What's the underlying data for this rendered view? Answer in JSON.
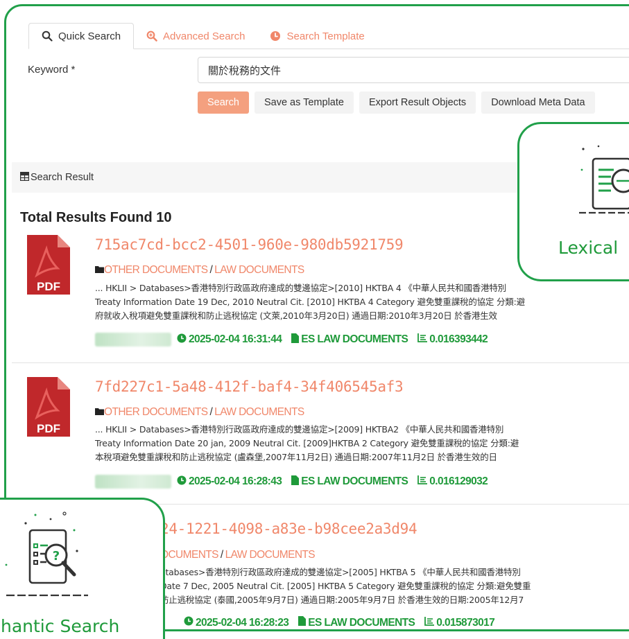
{
  "tabs": [
    {
      "label": "Quick Search",
      "icon": "search-icon",
      "active": true
    },
    {
      "label": "Advanced Search",
      "icon": "search-plus-icon",
      "active": false
    },
    {
      "label": "Search Template",
      "icon": "clock-icon",
      "active": false
    }
  ],
  "keyword": {
    "label": "Keyword *",
    "value": "關於稅務的文件"
  },
  "buttons": {
    "search": "Search",
    "save_template": "Save as Template",
    "export": "Export Result Objects",
    "download_meta": "Download Meta Data"
  },
  "result_bar": {
    "label": "Search Result"
  },
  "total": "Total Results Found 10",
  "results": [
    {
      "title": "715ac7cd-bcc2-4501-960e-980db5921759",
      "category": "OTHER DOCUMENTS",
      "subcategory": "LAW DOCUMENTS",
      "snippet": [
        "... HKLII > Databases>香港特別行政區政府達成的雙邊協定>[2010] HKTBA 4 《中華人民共和國香港特別",
        "Treaty Information Date 19 Dec, 2010 Neutral Cit. [2010] HKTBA 4 Category 避免雙重課稅的協定 分類:避",
        "府就收入稅項避免雙重課稅和防止逃稅協定 (文萊,2010年3月20日) 通過日期:2010年3月20日 於香港生效"
      ],
      "timestamp": "2025-02-04 16:31:44",
      "source": "ES LAW DOCUMENTS",
      "score": "0.016393442"
    },
    {
      "title": "7fd227c1-5a48-412f-baf4-34f406545af3",
      "category": "OTHER DOCUMENTS",
      "subcategory": "LAW DOCUMENTS",
      "snippet": [
        "... HKLII > Databases>香港特別行政區政府達成的雙邊協定>[2009] HKTBA2 《中華人民共和國香港特別",
        "Treaty Information Date 20 jan, 2009 Neutral Cit. [2009]HKTBA 2 Category 避免雙重課稅的協定 分類:避",
        "本稅項避免雙重課稅和防止逃稅協定 (盧森堡,2007年11月2日) 通過日期:2007年11月2日 於香港生效的日"
      ],
      "timestamp": "2025-02-04 16:28:43",
      "source": "ES LAW DOCUMENTS",
      "score": "0.016129032"
    },
    {
      "title": "24-1221-4098-a83e-b98cee2a3d94",
      "category": "OCUMENTS",
      "subcategory": "LAW DOCUMENTS",
      "snippet": [
        "atabases>香港特別行政區政府達成的雙邊協定>[2005] HKTBA 5 《中華人民共和國香港特別",
        " Date 7 Dec, 2005 Neutral Cit. [2005] HKTBA 5 Category 避免雙重課稅的協定 分類:避免雙重",
        "防止逃稅協定 (泰國,2005年9月7日) 通過日期:2005年9月7日 於香港生效的日期:2005年12月7"
      ],
      "timestamp": "2025-02-04 16:28:23",
      "source": "ES LAW DOCUMENTS",
      "score": "0.015873017"
    }
  ],
  "pdf_label": "PDF",
  "overlays": {
    "lexical": "Lexical",
    "semantic": "hantic Search"
  },
  "colors": {
    "accent": "#f0876a",
    "green": "#21a04a",
    "pdf_red": "#c0282b"
  }
}
